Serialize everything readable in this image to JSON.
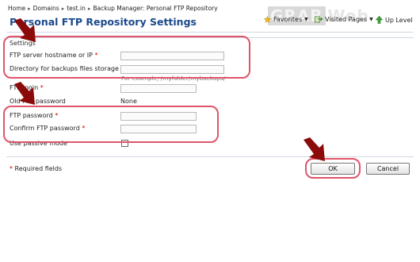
{
  "breadcrumb": [
    "Home",
    "Domains",
    "test.in",
    "Backup Manager: Personal FTP Repository"
  ],
  "page_title": "Personal FTP Repository Settings",
  "toolbar": {
    "favorites_label": "Favorites",
    "visited_pages_label": "Visited Pages",
    "up_level_label": "Up Level"
  },
  "watermark": {
    "text_a": "GRAB",
    "text_b": "Web"
  },
  "form": {
    "section_label": "Settings",
    "hostname_label": "FTP server hostname or IP",
    "hostname_value": "",
    "directory_label": "Directory for backups files storage",
    "directory_value": "",
    "directory_hint": "For example, /myfolder/mybackups/",
    "login_label": "FTP login",
    "login_value": "",
    "old_password_label": "Old FTP password",
    "old_password_value": "None",
    "password_label": "FTP password",
    "password_value": "",
    "confirm_password_label": "Confirm FTP password",
    "confirm_password_value": "",
    "passive_label": "Use passive mode",
    "passive_checked": false,
    "required_marker": "*",
    "required_note": "Required fields"
  },
  "buttons": {
    "ok_label": "OK",
    "cancel_label": "Cancel"
  },
  "colors": {
    "title": "#1b4a8c",
    "highlight": "#e0546a",
    "arrow": "#8b0a0a",
    "required": "#d60000"
  }
}
